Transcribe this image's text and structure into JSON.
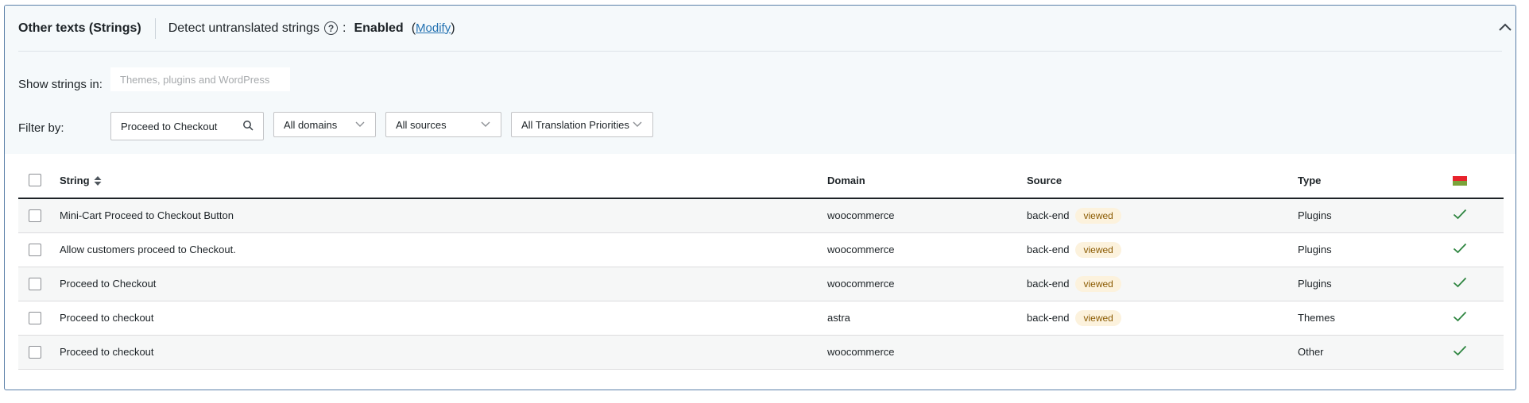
{
  "header": {
    "title": "Other texts (Strings)",
    "detect_label": "Detect untranslated strings",
    "help_glyph": "?",
    "colon": ":",
    "status": "Enabled",
    "paren_open": "(",
    "modify_label": "Modify",
    "paren_close": ")"
  },
  "filters": {
    "show_in_label": "Show strings in:",
    "show_in_placeholder": "Themes, plugins and WordPress",
    "filter_by_label": "Filter by:",
    "search_value": "Proceed to Checkout",
    "domain_select": "All domains",
    "source_select": "All sources",
    "priority_select": "All Translation Priorities"
  },
  "table": {
    "columns": {
      "string": "String",
      "domain": "Domain",
      "source": "Source",
      "type": "Type"
    },
    "rows": [
      {
        "string": "Mini-Cart Proceed to Checkout Button",
        "domain": "woocommerce",
        "source": "back-end",
        "badge": "viewed",
        "type": "Plugins"
      },
      {
        "string": "Allow customers proceed to Checkout.",
        "domain": "woocommerce",
        "source": "back-end",
        "badge": "viewed",
        "type": "Plugins"
      },
      {
        "string": "Proceed to Checkout",
        "domain": "woocommerce",
        "source": "back-end",
        "badge": "viewed",
        "type": "Plugins"
      },
      {
        "string": "Proceed to checkout",
        "domain": "astra",
        "source": "back-end",
        "badge": "viewed",
        "type": "Themes"
      },
      {
        "string": "Proceed to checkout",
        "domain": "woocommerce",
        "source": "",
        "badge": "",
        "type": "Other"
      }
    ]
  },
  "icons": {
    "help": "question-circle-icon",
    "collapse": "chevron-up-icon",
    "search": "search-icon",
    "dropdown": "chevron-down-icon",
    "sort": "sort-icon",
    "language_flag": "flag-icon",
    "translated": "checkmark-icon"
  },
  "colors": {
    "accent_link": "#2271b1",
    "badge_bg": "#fcf2dd",
    "badge_text": "#8a5a00",
    "check": "#2e8540",
    "flag_top": "#e8222c",
    "flag_bottom": "#7aa33a"
  }
}
